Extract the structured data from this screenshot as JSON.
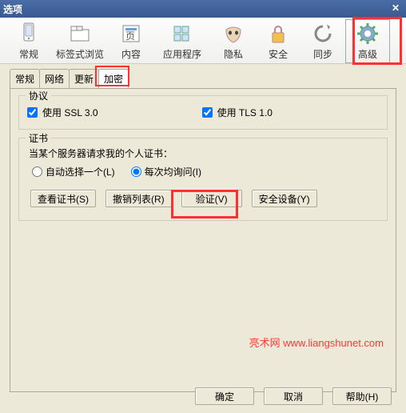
{
  "window": {
    "title": "选项"
  },
  "toolbar": {
    "items": [
      {
        "label": "常规"
      },
      {
        "label": "标签式浏览"
      },
      {
        "label": "内容"
      },
      {
        "label": "应用程序"
      },
      {
        "label": "隐私"
      },
      {
        "label": "安全"
      },
      {
        "label": "同步"
      },
      {
        "label": "高级"
      }
    ]
  },
  "tabs": {
    "items": [
      {
        "label": "常规"
      },
      {
        "label": "网络"
      },
      {
        "label": "更新"
      },
      {
        "label": "加密"
      }
    ]
  },
  "protocol": {
    "legend": "协议",
    "ssl": "使用 SSL 3.0",
    "tls": "使用 TLS 1.0"
  },
  "cert": {
    "legend": "证书",
    "desc": "当某个服务器请求我的个人证书：",
    "auto": "自动选择一个(L)",
    "ask": "每次均询问(I)",
    "view": "查看证书(S)",
    "revoke": "撤销列表(R)",
    "verify": "验证(V)",
    "device": "安全设备(Y)"
  },
  "watermark": "亮术网 www.liangshunet.com",
  "footer": {
    "ok": "确定",
    "cancel": "取消",
    "help": "帮助(H)"
  }
}
